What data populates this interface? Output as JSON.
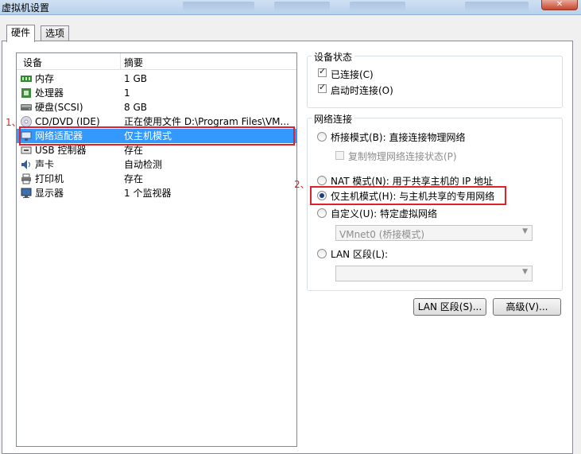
{
  "window": {
    "title": "虚拟机设置",
    "close_glyph": "✕"
  },
  "tabs": [
    {
      "label": "硬件"
    },
    {
      "label": "选项"
    }
  ],
  "device_list": {
    "headers": {
      "device": "设备",
      "summary": "摘要"
    },
    "items": [
      {
        "name": "内存",
        "summary": "1 GB",
        "icon": "memory-icon"
      },
      {
        "name": "处理器",
        "summary": "1",
        "icon": "processor-icon"
      },
      {
        "name": "硬盘(SCSI)",
        "summary": "8 GB",
        "icon": "hard-disk-icon"
      },
      {
        "name": "CD/DVD (IDE)",
        "summary": "正在使用文件 D:\\Program Files\\VM...",
        "icon": "cd-dvd-icon"
      },
      {
        "name": "网络适配器",
        "summary": "仅主机模式",
        "icon": "network-adapter-icon",
        "selected": true
      },
      {
        "name": "USB 控制器",
        "summary": "存在",
        "icon": "usb-icon"
      },
      {
        "name": "声卡",
        "summary": "自动检测",
        "icon": "sound-card-icon"
      },
      {
        "name": "打印机",
        "summary": "存在",
        "icon": "printer-icon"
      },
      {
        "name": "显示器",
        "summary": "1 个监视器",
        "icon": "display-icon"
      }
    ]
  },
  "device_status": {
    "title": "设备状态",
    "connected": {
      "label": "已连接(C)",
      "checked": true
    },
    "connect_at_power_on": {
      "label": "启动时连接(O)",
      "checked": true
    }
  },
  "network_connection": {
    "title": "网络连接",
    "bridged": {
      "label": "桥接模式(B): 直接连接物理网络"
    },
    "replicate": {
      "label": "复制物理网络连接状态(P)"
    },
    "nat": {
      "label": "NAT 模式(N): 用于共享主机的 IP 地址"
    },
    "host_only": {
      "label": "仅主机模式(H): 与主机共享的专用网络",
      "checked": true
    },
    "custom": {
      "label": "自定义(U): 特定虚拟网络",
      "value": "VMnet0 (桥接模式)"
    },
    "lan_segment": {
      "label": "LAN 区段(L):",
      "value": ""
    }
  },
  "buttons": {
    "lan_segments": "LAN 区段(S)...",
    "advanced": "高级(V)..."
  },
  "annotations": {
    "one": "1、",
    "two": "2、"
  },
  "colors": {
    "selection": "#3399ff",
    "annotation_red": "#e0202a"
  }
}
